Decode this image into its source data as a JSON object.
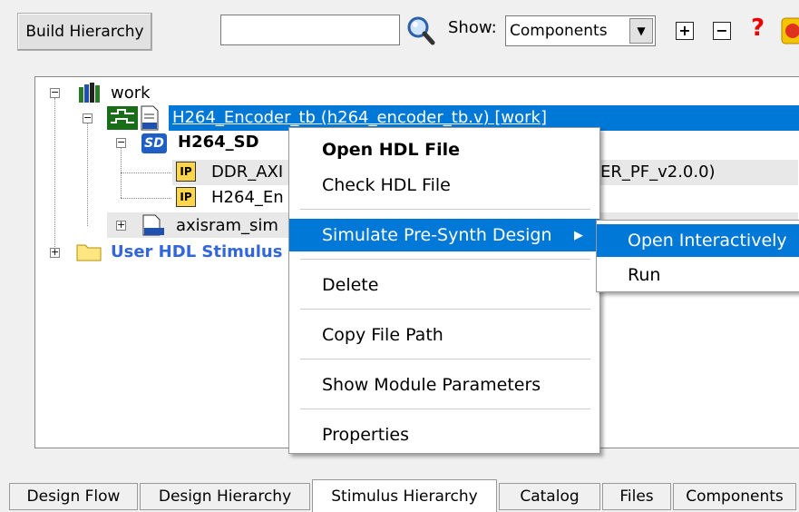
{
  "toolbar": {
    "build_button": "Build Hierarchy",
    "search_value": "",
    "show_label": "Show:",
    "show_selected": "Components",
    "expand_symbol": "+",
    "collapse_symbol": "−",
    "help_symbol": "?"
  },
  "tree": {
    "work": "work",
    "selected": "H264_Encoder_tb (h264_encoder_tb.v) [work]",
    "sd_badge": "SD",
    "sd": "H264_SD",
    "ip_badge": "IP",
    "ddr": "DDR_AXI",
    "ddr_suffix": "ER_PF_v2.0.0)",
    "h264en": "H264_En",
    "axisram": "axisram_sim",
    "user_hdl": "User HDL Stimulus"
  },
  "context_menu": {
    "items": [
      "Open HDL File",
      "Check HDL File",
      "Simulate Pre-Synth Design",
      "Delete",
      "Copy File Path",
      "Show Module Parameters",
      "Properties"
    ],
    "submenu_arrow": "▶"
  },
  "submenu": {
    "items": [
      "Open Interactively",
      "Run"
    ]
  },
  "tabs": [
    "Design Flow",
    "Design Hierarchy",
    "Stimulus Hierarchy",
    "Catalog",
    "Files",
    "Components"
  ],
  "colors": {
    "selection": "#0078d7",
    "user_hdl_text": "#3366dd"
  }
}
